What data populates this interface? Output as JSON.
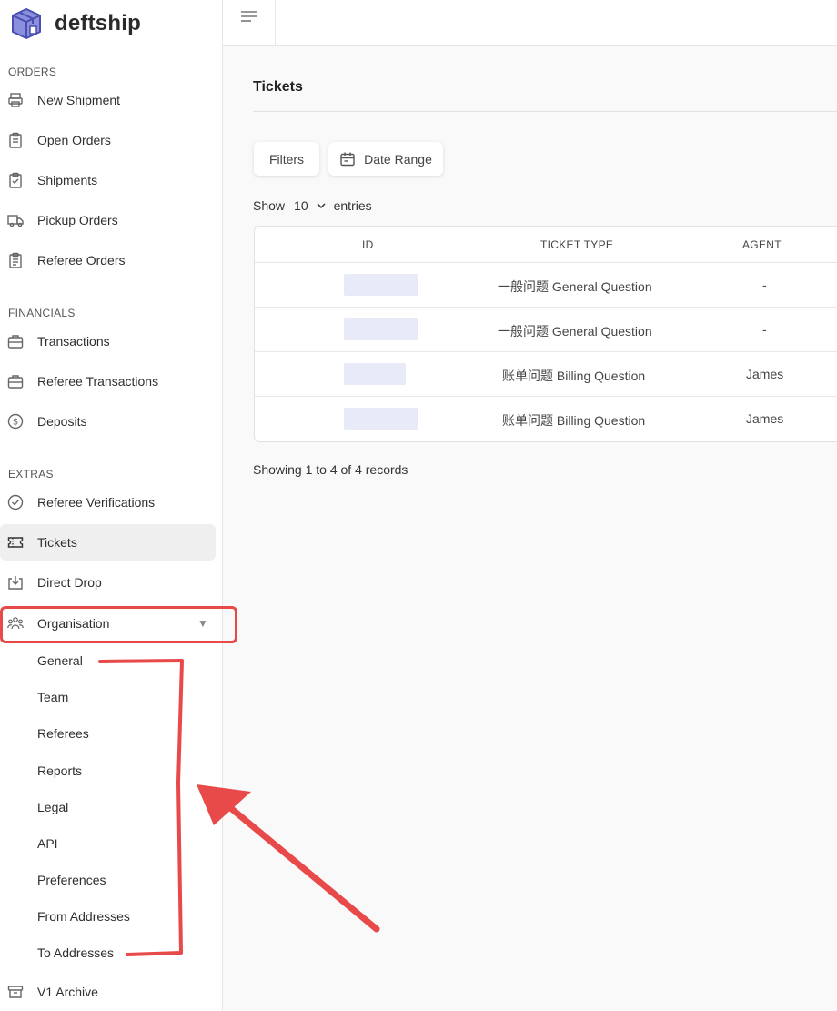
{
  "app": {
    "name": "deftship"
  },
  "sidebar": {
    "orders": {
      "title": "ORDERS",
      "items": [
        {
          "label": "New Shipment",
          "icon": "printer-icon"
        },
        {
          "label": "Open Orders",
          "icon": "clipboard-icon"
        },
        {
          "label": "Shipments",
          "icon": "clipboard-check-icon"
        },
        {
          "label": "Pickup Orders",
          "icon": "truck-icon"
        },
        {
          "label": "Referee Orders",
          "icon": "clipboard-list-icon"
        }
      ]
    },
    "financials": {
      "title": "FINANCIALS",
      "items": [
        {
          "label": "Transactions",
          "icon": "briefcase-icon"
        },
        {
          "label": "Referee Transactions",
          "icon": "briefcase-icon"
        },
        {
          "label": "Deposits",
          "icon": "dollar-circle-icon"
        }
      ]
    },
    "extras": {
      "title": "EXTRAS",
      "items": [
        {
          "label": "Referee Verifications",
          "icon": "check-circle-icon"
        },
        {
          "label": "Tickets",
          "icon": "ticket-icon"
        },
        {
          "label": "Direct Drop",
          "icon": "download-box-icon"
        },
        {
          "label": "Organisation",
          "icon": "users-icon"
        }
      ]
    },
    "organisation_sub": [
      "General",
      "Team",
      "Referees",
      "Reports",
      "Legal",
      "API",
      "Preferences",
      "From Addresses",
      "To Addresses"
    ],
    "archive": {
      "label": "V1 Archive",
      "icon": "archive-icon"
    },
    "caret": "▼"
  },
  "main": {
    "title": "Tickets",
    "filters_label": "Filters",
    "date_range_label": "Date Range",
    "show": {
      "prefix": "Show",
      "value": "10",
      "suffix": "entries"
    },
    "table": {
      "headers": [
        "ID",
        "TICKET TYPE",
        "AGENT"
      ],
      "rows": [
        {
          "ticket_type": "一般问题 General Question",
          "agent": "-"
        },
        {
          "ticket_type": "一般问题 General Question",
          "agent": "-"
        },
        {
          "ticket_type": "账单问题 Billing Question",
          "agent": "James"
        },
        {
          "ticket_type": "账单问题 Billing Question",
          "agent": "James"
        }
      ]
    },
    "footer": "Showing 1 to 4 of 4 records"
  },
  "colors": {
    "annotation": "#e84a4a",
    "brand": "#6b6fd0",
    "active_bg": "#efefef"
  }
}
